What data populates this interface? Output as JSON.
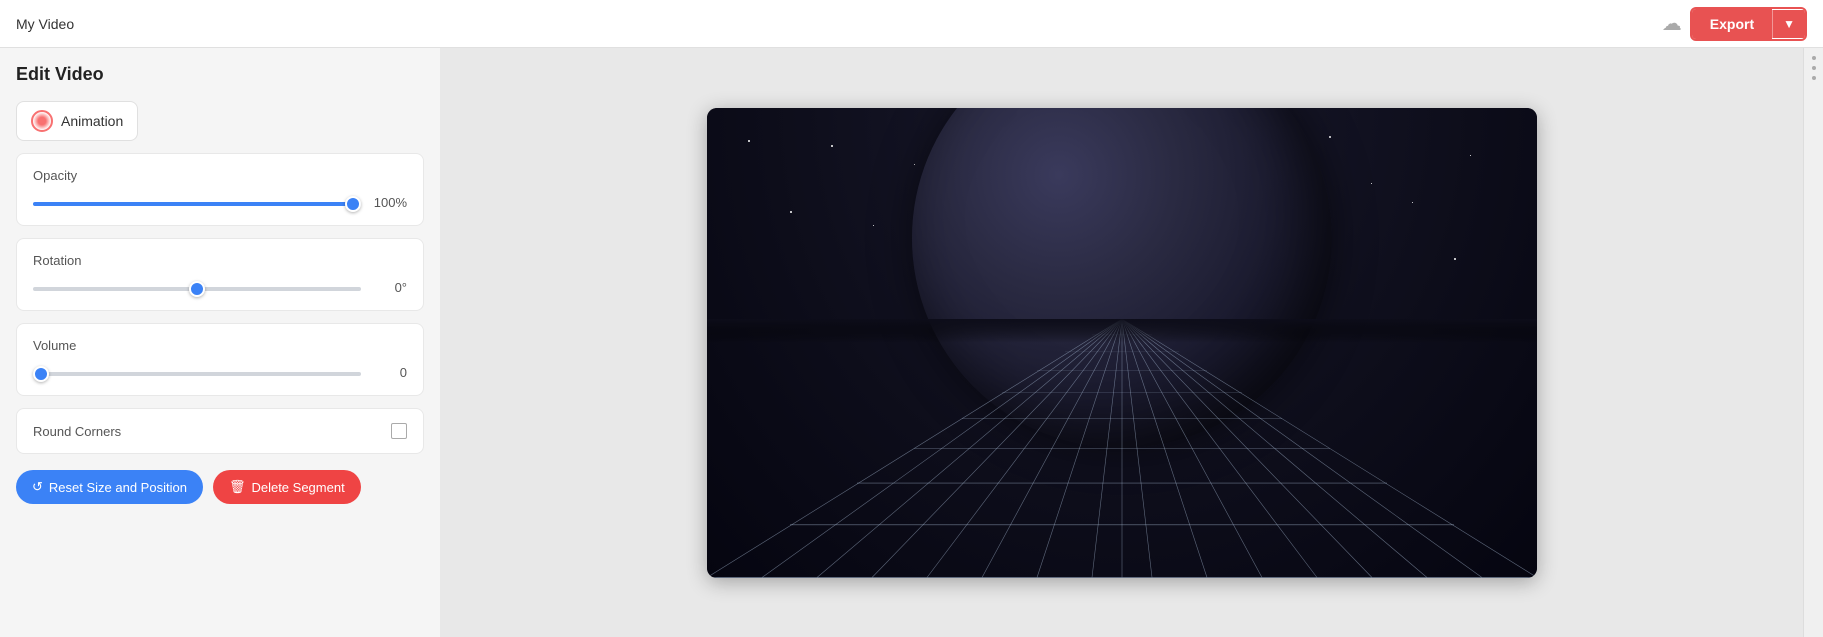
{
  "header": {
    "title": "My Video",
    "cloud_icon": "☁",
    "export_label": "Export",
    "export_chevron": "▼"
  },
  "left_panel": {
    "page_title": "Edit Video",
    "animation_button_label": "Animation",
    "opacity": {
      "label": "Opacity",
      "value": 100,
      "display": "100%",
      "min": 0,
      "max": 100
    },
    "rotation": {
      "label": "Rotation",
      "value": 0,
      "display": "0°",
      "min": -180,
      "max": 180
    },
    "volume": {
      "label": "Volume",
      "value": 0,
      "display": "0",
      "min": 0,
      "max": 100
    },
    "round_corners": {
      "label": "Round Corners",
      "checked": false
    },
    "reset_btn_label": "Reset Size and Position",
    "delete_btn_label": "Delete Segment"
  },
  "colors": {
    "export_red": "#e85252",
    "blue_accent": "#3b82f6",
    "delete_red": "#ef4444"
  }
}
